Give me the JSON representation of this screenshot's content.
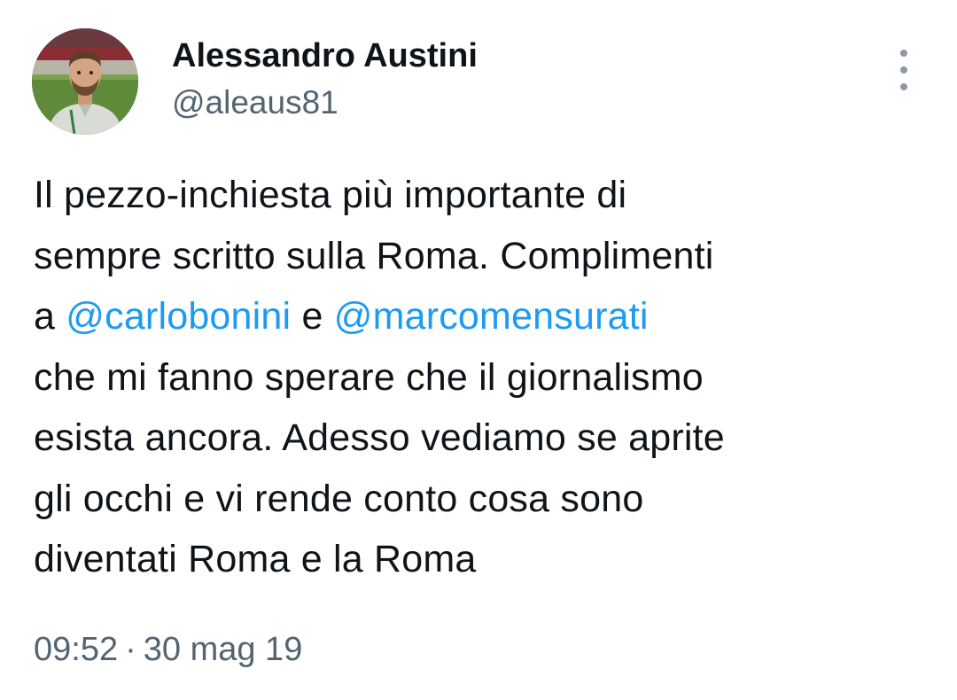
{
  "author": {
    "name": "Alessandro Austini",
    "handle": "@aleaus81",
    "avatar_icon": "profile-photo"
  },
  "more_icon": "vertical-ellipsis-icon",
  "tweet": {
    "lines": [
      {
        "before": "Il pezzo-inchiesta più importante di"
      },
      {
        "before": "sempre scritto sulla Roma. Complimenti"
      },
      {
        "before": "a ",
        "mention1": "@carlobonini",
        "middle": " e ",
        "mention2": "@marcomensurati"
      },
      {
        "before": "che mi fanno sperare che il giornalismo"
      },
      {
        "before": "esista ancora. Adesso vediamo se aprite"
      },
      {
        "before": "gli occhi e vi rende conto cosa sono"
      },
      {
        "before": "diventati Roma e la Roma"
      }
    ]
  },
  "meta": {
    "time": "09:52",
    "separator": "·",
    "date": "30 mag 19"
  },
  "colors": {
    "text": "#0f1419",
    "secondary": "#536471",
    "mention": "#1d9bf0",
    "background": "#ffffff"
  }
}
